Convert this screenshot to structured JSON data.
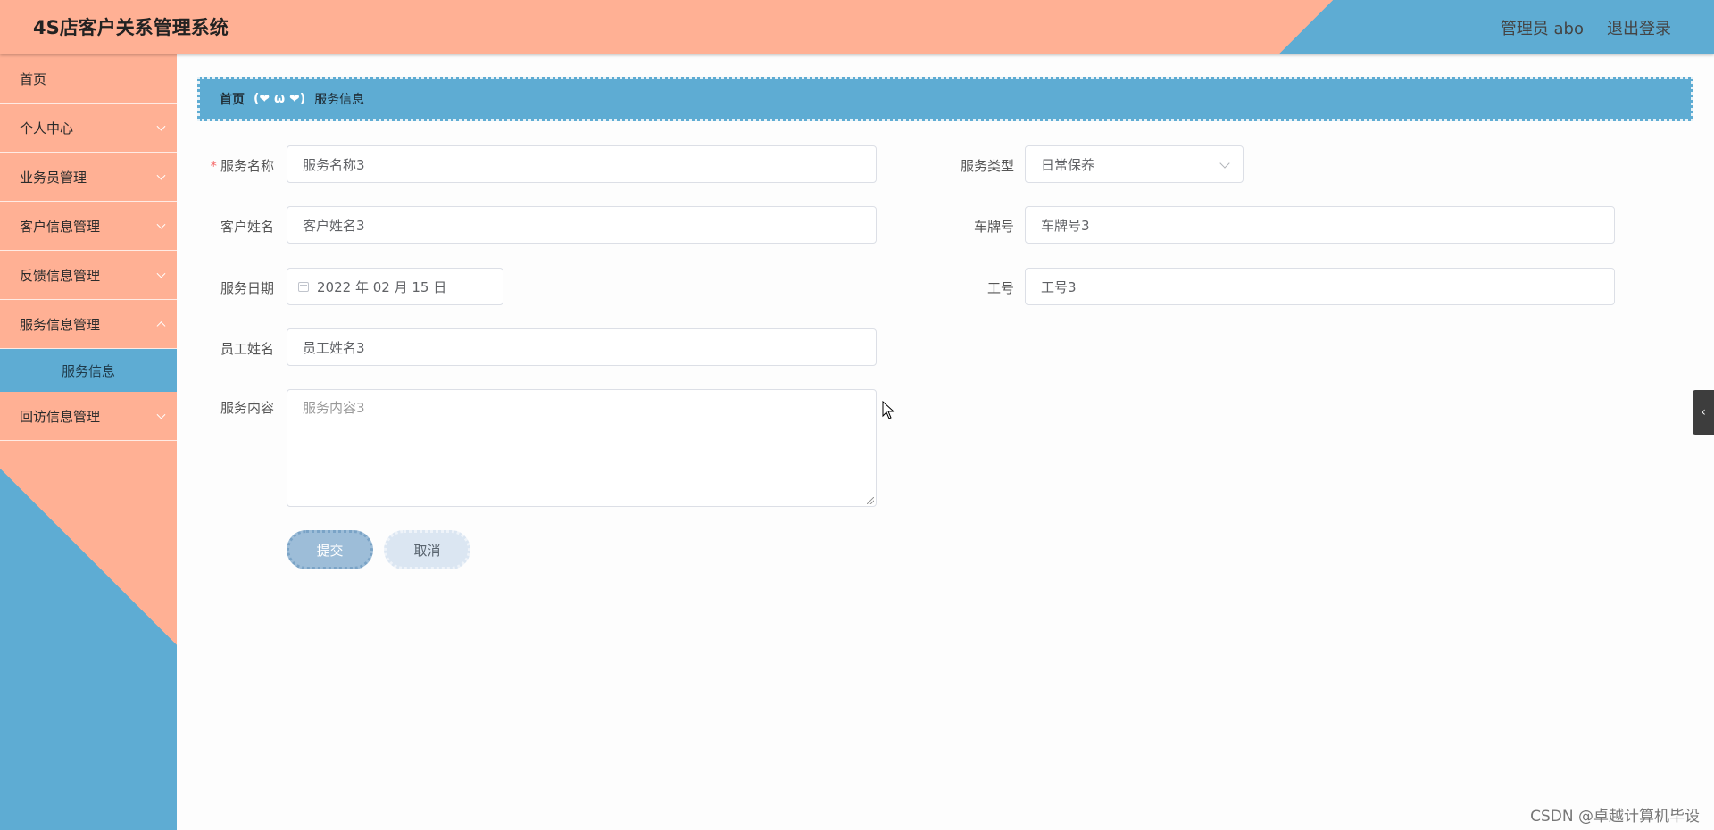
{
  "header": {
    "title": "4S店客户关系管理系统",
    "user": "管理员 abo",
    "logout": "退出登录"
  },
  "sidebar": {
    "items": [
      {
        "label": "首页"
      },
      {
        "label": "个人中心"
      },
      {
        "label": "业务员管理"
      },
      {
        "label": "客户信息管理"
      },
      {
        "label": "反馈信息管理"
      },
      {
        "label": "服务信息管理"
      },
      {
        "label": "回访信息管理"
      }
    ],
    "submenu_active": "服务信息"
  },
  "breadcrumb": {
    "home": "首页",
    "separator": "(❤ ω ❤)",
    "current": "服务信息"
  },
  "form": {
    "service_name": {
      "label": "服务名称",
      "value": "服务名称3",
      "required": "*"
    },
    "service_type": {
      "label": "服务类型",
      "value": "日常保养"
    },
    "customer_name": {
      "label": "客户姓名",
      "value": "客户姓名3"
    },
    "plate_number": {
      "label": "车牌号",
      "value": "车牌号3"
    },
    "service_date": {
      "label": "服务日期",
      "value": "2022 年 02 月 15 日"
    },
    "employee_id": {
      "label": "工号",
      "value": "工号3"
    },
    "employee_name": {
      "label": "员工姓名",
      "value": "员工姓名3"
    },
    "service_content": {
      "label": "服务内容",
      "value": "服务内容3"
    },
    "submit": "提交",
    "cancel": "取消"
  },
  "watermark": "CSDN @卓越计算机毕设",
  "colors": {
    "salmon": "#ffb094",
    "blue": "#5eacd3"
  },
  "icons": [
    "chevron-down-icon",
    "calendar-icon",
    "chevron-left-icon"
  ]
}
